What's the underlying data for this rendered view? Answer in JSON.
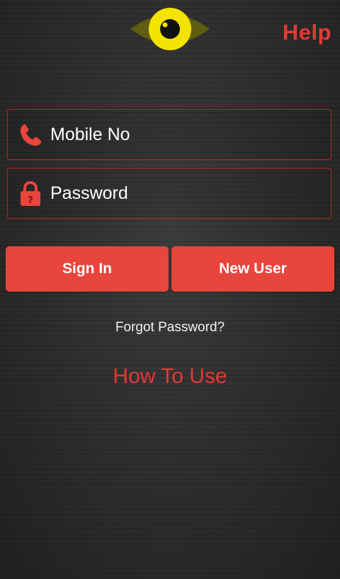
{
  "header": {
    "logo_icon": "eye-icon",
    "help_label": "Help"
  },
  "form": {
    "mobile": {
      "icon": "phone-icon",
      "placeholder": "Mobile No",
      "value": ""
    },
    "password": {
      "icon": "lock-icon",
      "placeholder": "Password",
      "value": ""
    }
  },
  "actions": {
    "sign_in_label": "Sign In",
    "new_user_label": "New User",
    "forgot_password_label": "Forgot Password?",
    "how_to_use_label": "How To Use"
  },
  "colors": {
    "accent": "#e8453c",
    "accent_text": "#e53935",
    "logo_yellow": "#f4e300",
    "logo_dark": "#6b6a12"
  }
}
